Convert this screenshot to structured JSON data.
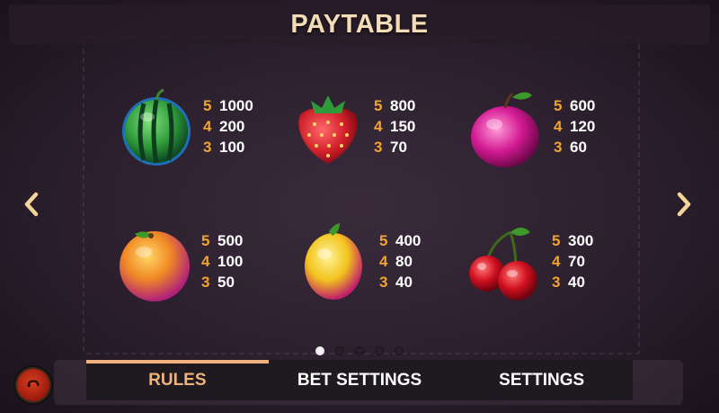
{
  "header": {
    "title": "PAYTABLE"
  },
  "symbols": [
    {
      "name": "watermelon",
      "pays": [
        {
          "count": "5",
          "value": "1000"
        },
        {
          "count": "4",
          "value": "200"
        },
        {
          "count": "3",
          "value": "100"
        }
      ]
    },
    {
      "name": "strawberry",
      "pays": [
        {
          "count": "5",
          "value": "800"
        },
        {
          "count": "4",
          "value": "150"
        },
        {
          "count": "3",
          "value": "70"
        }
      ]
    },
    {
      "name": "plum",
      "pays": [
        {
          "count": "5",
          "value": "600"
        },
        {
          "count": "4",
          "value": "120"
        },
        {
          "count": "3",
          "value": "60"
        }
      ]
    },
    {
      "name": "orange",
      "pays": [
        {
          "count": "5",
          "value": "500"
        },
        {
          "count": "4",
          "value": "100"
        },
        {
          "count": "3",
          "value": "50"
        }
      ]
    },
    {
      "name": "lemon",
      "pays": [
        {
          "count": "5",
          "value": "400"
        },
        {
          "count": "4",
          "value": "80"
        },
        {
          "count": "3",
          "value": "40"
        }
      ]
    },
    {
      "name": "cherries",
      "pays": [
        {
          "count": "5",
          "value": "300"
        },
        {
          "count": "4",
          "value": "70"
        },
        {
          "count": "3",
          "value": "40"
        }
      ]
    }
  ],
  "pager": {
    "pages": 5,
    "active_page": 1
  },
  "tabs": [
    {
      "label": "RULES",
      "active": true
    },
    {
      "label": "BET SETTINGS",
      "active": false
    },
    {
      "label": "SETTINGS",
      "active": false
    }
  ],
  "icons": {
    "prev": "chevron-left-icon",
    "next": "chevron-right-icon",
    "home": "home-icon"
  },
  "colors": {
    "title": "#f4ddb6",
    "count": "#f0a531",
    "value": "#ffffff",
    "active_tab": "#efb27c",
    "tab_bar": "#1e1a1f"
  }
}
